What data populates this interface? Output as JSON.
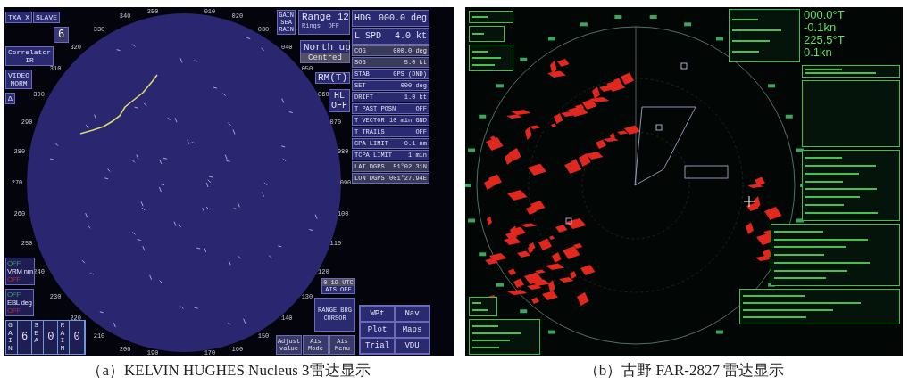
{
  "panel_a": {
    "txa": "TXA X",
    "slave": "SLAVE",
    "level_digit": "6",
    "correlator": "Correlator\nIR",
    "video": "VIDEO\nNORM",
    "delta": "Δ",
    "range_markers": [
      {
        "top": "OFF",
        "label": "VRM nm",
        "bottom": "OFF"
      },
      {
        "top": "OFF",
        "label": "EBL deg",
        "bottom": "OFF"
      }
    ],
    "clutter": [
      {
        "label": "GAIN",
        "value": "6"
      },
      {
        "label": "SEA",
        "value": "0"
      },
      {
        "label": "RAIN",
        "value": "0"
      }
    ],
    "clutter_menu": "GAIN\nSEA\nRAIN",
    "range_label": "Range",
    "range_value": "12",
    "rings": "Rings  OFF",
    "orientation": "North up",
    "centring": "Centred",
    "motion": "RM(T)",
    "heading_line": "HL\nOFF",
    "readouts": [
      {
        "label": "HDG",
        "value": "000.0 deg",
        "kind": "large"
      },
      {
        "label": "L SPD",
        "value": "4.0 kt",
        "kind": "large"
      },
      {
        "label": "COG",
        "value": "000.0 deg",
        "kind": "shaded"
      },
      {
        "label": "SOG",
        "value": "5.0 kt",
        "kind": "shaded"
      },
      {
        "label": "STAB",
        "value": "GPS (DND)",
        "kind": "small"
      },
      {
        "label": "SET",
        "value": "000 deg",
        "kind": "small"
      },
      {
        "label": "DRIFT",
        "value": "1.0 kt",
        "kind": "small"
      },
      {
        "label": "T PAST POSN",
        "value": "OFF",
        "kind": "small"
      },
      {
        "label": "T VECTOR",
        "value": "10 min GND",
        "kind": "small"
      },
      {
        "label": "T TRAILS",
        "value": "OFF",
        "kind": "small"
      },
      {
        "label": "CPA LIMIT",
        "value": "0.1 nm",
        "kind": "small"
      },
      {
        "label": "TCPA LIMIT",
        "value": "1 min",
        "kind": "small"
      },
      {
        "label": "LAT DGPS",
        "value": "51°02.31N",
        "kind": "shaded"
      },
      {
        "label": "LON DGPS",
        "value": "001°27.94E",
        "kind": "shaded"
      }
    ],
    "utc": "0:19 UTC",
    "ais": "AIS OFF",
    "cursor": "RANGE BRG\nCURSOR",
    "soft_keys": [
      "Adjust\nvalue",
      "Ais\nMode",
      "Ais\nMenu"
    ],
    "menu_buttons": [
      "WPt",
      "Nav",
      "Plot",
      "Maps",
      "Trial",
      "VDU"
    ],
    "bearings": [
      "350",
      "010",
      "340",
      "020",
      "330",
      "030",
      "320",
      "040",
      "310",
      "050",
      "300",
      "060",
      "290",
      "070",
      "280",
      "080",
      "270",
      "090",
      "260",
      "100",
      "250",
      "110",
      "240",
      "120",
      "230",
      "130",
      "220",
      "140",
      "210",
      "150",
      "200",
      "160",
      "190",
      "170"
    ],
    "caption": "（a）KELVIN HUGHES Nucleus 3雷达显示"
  },
  "panel_b": {
    "readouts": [
      {
        "value": "000.0°T"
      },
      {
        "value": "-0.1kn"
      },
      {
        "value": "225.5°T"
      },
      {
        "value": "0.1kn"
      }
    ],
    "caption": "（b）古野 FAR-2827 雷达显示"
  }
}
